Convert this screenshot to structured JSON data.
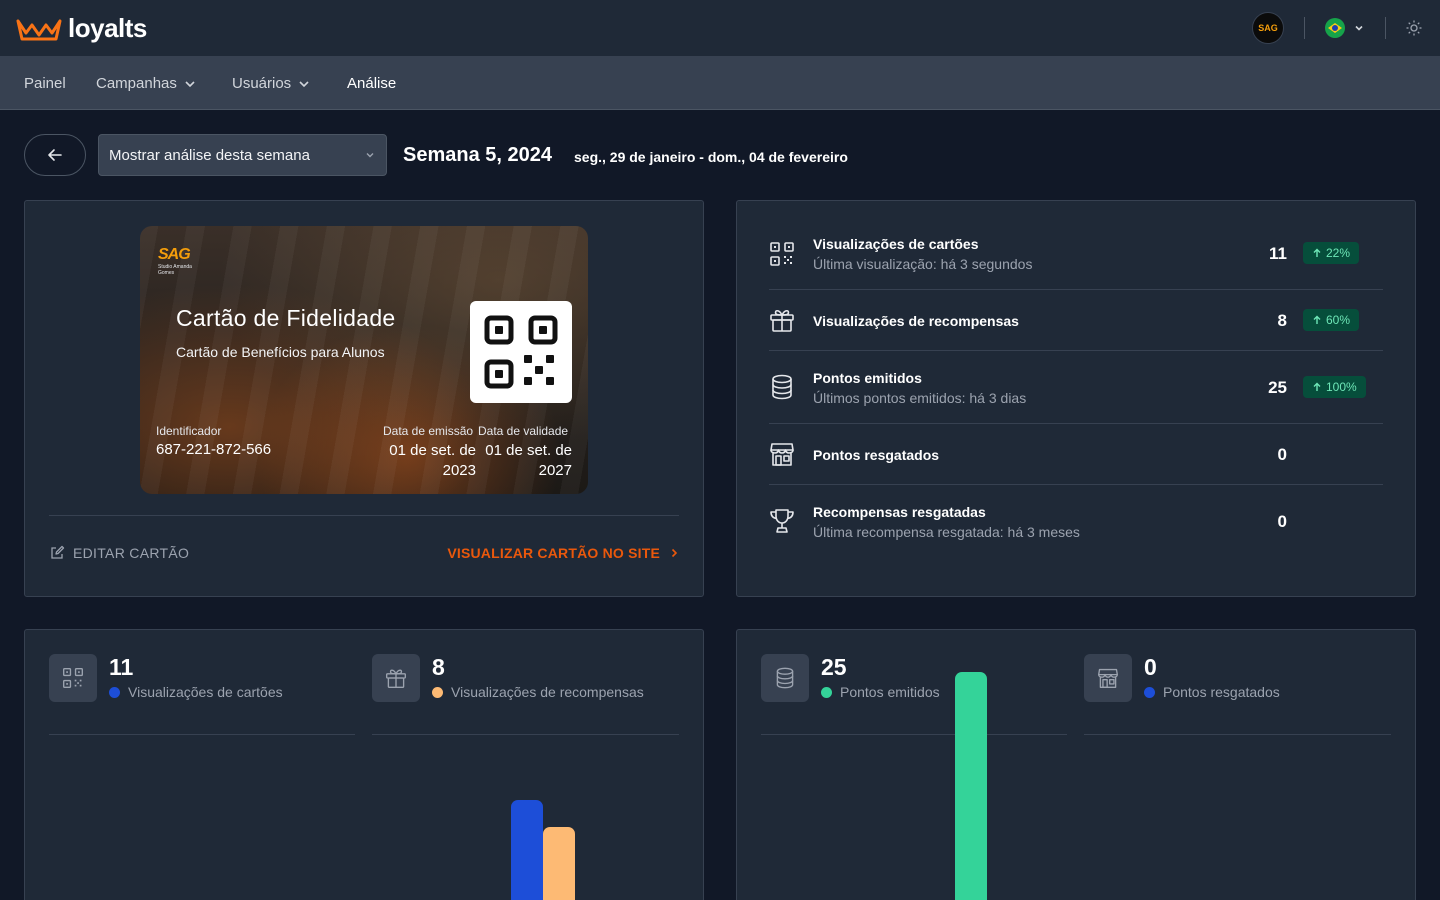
{
  "app": {
    "name": "loyalts",
    "org_initials": "SAG"
  },
  "nav": {
    "items": [
      "Painel",
      "Campanhas",
      "Usuários",
      "Análise"
    ],
    "active": "Análise"
  },
  "week": {
    "select_label": "Mostrar análise desta semana",
    "title": "Semana 5, 2024",
    "range": "seg., 29 de janeiro - dom., 04 de fevereiro"
  },
  "card": {
    "logo_text": "SAG",
    "logo_caption": "Studio Amanda Gomes",
    "title": "Cartão de Fidelidade",
    "subtitle": "Cartão de Benefícios para Alunos",
    "id_label": "Identificador",
    "id_value": "687-221-872-566",
    "issue_label": "Data de emissão",
    "issue_value": "01 de set. de 2023",
    "exp_label": "Data de validade",
    "exp_value": "01 de set. de 2027",
    "edit_label": "EDITAR CARTÃO",
    "view_label": "VISUALIZAR CARTÃO NO SITE"
  },
  "stats": [
    {
      "icon": "qr-code-icon",
      "title": "Visualizações de cartões",
      "sub": "Última visualização: há 3 segundos",
      "value": "11",
      "badge": "22%"
    },
    {
      "icon": "gift-icon",
      "title": "Visualizações de recompensas",
      "sub": "",
      "value": "8",
      "badge": "60%"
    },
    {
      "icon": "coins-icon",
      "title": "Pontos emitidos",
      "sub": "Últimos pontos emitidos: há 3 dias",
      "value": "25",
      "badge": "100%"
    },
    {
      "icon": "store-icon",
      "title": "Pontos resgatados",
      "sub": "",
      "value": "0",
      "badge": ""
    },
    {
      "icon": "trophy-icon",
      "title": "Recompensas resgatadas",
      "sub": "Última recompensa resgatada: há 3 meses",
      "value": "0",
      "badge": ""
    }
  ],
  "metrics_left": [
    {
      "icon": "qr-code-icon",
      "value": "11",
      "label": "Visualizações de cartões",
      "color": "#1d4ed8"
    },
    {
      "icon": "gift-icon",
      "value": "8",
      "label": "Visualizações de recompensas",
      "color": "#fdba74"
    }
  ],
  "metrics_right": [
    {
      "icon": "coins-icon",
      "value": "25",
      "label": "Pontos emitidos",
      "color": "#34d399"
    },
    {
      "icon": "store-icon",
      "value": "0",
      "label": "Pontos resgatados",
      "color": "#1d4ed8"
    }
  ],
  "chart_data": [
    {
      "type": "bar",
      "series": [
        {
          "values": [
            11
          ],
          "color": "#1d4ed8"
        },
        {
          "values": [
            8
          ],
          "color": "#fdba74"
        }
      ]
    },
    {
      "type": "bar",
      "series": [
        {
          "values": [
            25
          ],
          "color": "#34d399"
        },
        {
          "values": [
            0
          ],
          "color": "#1d4ed8"
        }
      ]
    }
  ]
}
